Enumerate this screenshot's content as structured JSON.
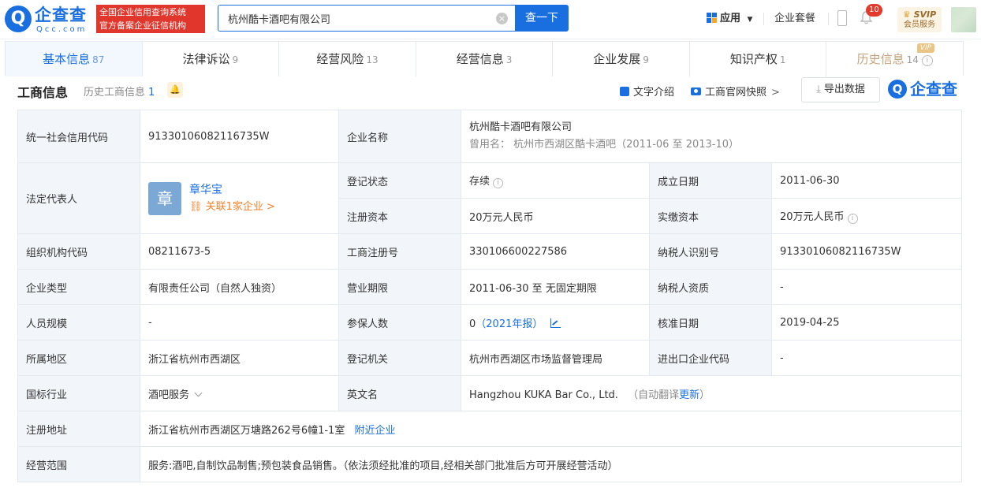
{
  "header": {
    "logo_title": "企查查",
    "logo_url": "Qcc.com",
    "slogan_line1": "全国企业信用查询系统",
    "slogan_line2": "官方备案企业征信机构",
    "search_value": "杭州酷卡酒吧有限公司",
    "search_button": "查一下",
    "app_menu": "应用",
    "package": "企业套餐",
    "notification_count": "10",
    "svip_label": "SVIP",
    "member_service": "会员服务"
  },
  "tabs": [
    {
      "label": "基本信息",
      "count": "87"
    },
    {
      "label": "法律诉讼",
      "count": "9"
    },
    {
      "label": "经营风险",
      "count": "13"
    },
    {
      "label": "经营信息",
      "count": "3"
    },
    {
      "label": "企业发展",
      "count": "9"
    },
    {
      "label": "知识产权",
      "count": "1"
    },
    {
      "label": "历史信息",
      "count": "14",
      "badge": "VIP"
    }
  ],
  "section": {
    "title": "工商信息",
    "history_label": "历史工商信息",
    "history_count": "1",
    "text_intro": "文字介绍",
    "official_snapshot": "工商官网快照",
    "export": "导出数据",
    "brand": "企查查"
  },
  "info": {
    "credit_code_label": "统一社会信用代码",
    "credit_code": "91330106082116735W",
    "company_name_label": "企业名称",
    "company_name": "杭州酷卡酒吧有限公司",
    "former_name": "曾用名： 杭州市西湖区酷卡酒吧（2011-06 至 2013-10）",
    "legal_rep_label": "法定代表人",
    "legal_rep_avatar": "章",
    "legal_rep_name": "章华宝",
    "legal_rep_link": "关联1家企业 >",
    "reg_status_label": "登记状态",
    "reg_status": "存续",
    "founded_label": "成立日期",
    "founded": "2011-06-30",
    "reg_capital_label": "注册资本",
    "reg_capital": "20万元人民币",
    "paid_capital_label": "实缴资本",
    "paid_capital": "20万元人民币",
    "org_code_label": "组织机构代码",
    "org_code": "08211673-5",
    "reg_no_label": "工商注册号",
    "reg_no": "330106600227586",
    "taxpayer_id_label": "纳税人识别号",
    "taxpayer_id": "91330106082116735W",
    "company_type_label": "企业类型",
    "company_type": "有限责任公司（自然人独资）",
    "term_label": "营业期限",
    "term": "2011-06-30 至 无固定期限",
    "taxpayer_qual_label": "纳税人资质",
    "taxpayer_qual": "-",
    "staff_size_label": "人员规模",
    "staff_size": "-",
    "insured_label": "参保人数",
    "insured_value": "0",
    "insured_report": "（2021年报）",
    "approval_date_label": "核准日期",
    "approval_date": "2019-04-25",
    "region_label": "所属地区",
    "region": "浙江省杭州市西湖区",
    "authority_label": "登记机关",
    "authority": "杭州市西湖区市场监督管理局",
    "ie_code_label": "进出口企业代码",
    "ie_code": "-",
    "industry_label": "国标行业",
    "industry": "酒吧服务",
    "english_name_label": "英文名",
    "english_name": "Hangzhou KUKA Bar Co., Ltd.",
    "auto_translate": "（自动翻译",
    "update_link": "更新",
    "auto_translate_end": "）",
    "address_label": "注册地址",
    "address": "浙江省杭州市西湖区万塘路262号6幢1-1室",
    "nearby_link": "附近企业",
    "scope_label": "经营范围",
    "scope": "服务:酒吧,自制饮品制售;预包装食品销售。（依法须经批准的项目,经相关部门批准后方可开展经营活动）"
  },
  "colors": {
    "accent": "#1a6fe0",
    "slogan_bg": "#e0362c",
    "label_bg": "#f2f6fb",
    "link_orange": "#f5822a"
  }
}
